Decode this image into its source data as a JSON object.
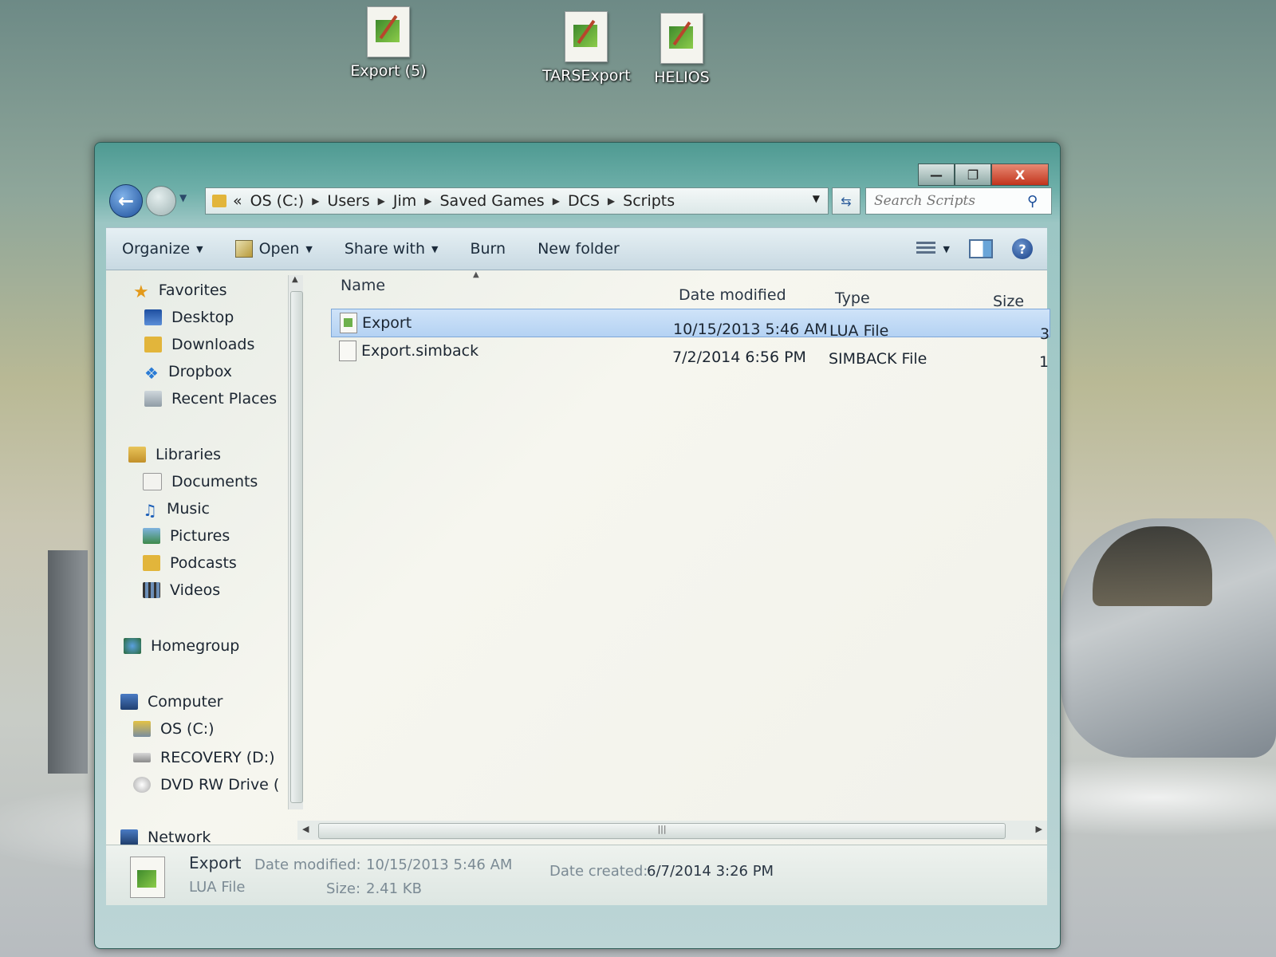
{
  "desktop": {
    "icons": [
      {
        "label": "Export (5)"
      },
      {
        "label": "TARSExport"
      },
      {
        "label": "HELIOS"
      }
    ]
  },
  "window": {
    "controls": {
      "minimize": "—",
      "maximize": "❐",
      "close": "X"
    },
    "breadcrumb": {
      "overflow": "«",
      "crumbs": [
        "OS (C:)",
        "Users",
        "Jim",
        "Saved Games",
        "DCS",
        "Scripts"
      ]
    },
    "search": {
      "placeholder": "Search Scripts"
    },
    "toolbar": {
      "organize": "Organize",
      "open": "Open",
      "share_with": "Share with",
      "burn": "Burn",
      "new_folder": "New folder"
    },
    "nav": {
      "favorites": "Favorites",
      "desktop": "Desktop",
      "downloads": "Downloads",
      "dropbox": "Dropbox",
      "recent_places": "Recent Places",
      "libraries": "Libraries",
      "documents": "Documents",
      "music": "Music",
      "pictures": "Pictures",
      "podcasts": "Podcasts",
      "videos": "Videos",
      "homegroup": "Homegroup",
      "computer": "Computer",
      "os_c": "OS (C:)",
      "recovery_d": "RECOVERY (D:)",
      "dvd": "DVD RW Drive (",
      "network": "Network"
    },
    "columns": {
      "name": "Name",
      "date": "Date modified",
      "type": "Type",
      "size": "Size"
    },
    "files": [
      {
        "name": "Export",
        "date": "10/15/2013 5:46 AM",
        "type": "LUA File",
        "size": "3",
        "selected": true
      },
      {
        "name": "Export.simback",
        "date": "7/2/2014 6:56 PM",
        "type": "SIMBACK File",
        "size": "1",
        "selected": false
      }
    ],
    "details": {
      "name": "Export",
      "type": "LUA File",
      "date_modified_label": "Date modified:",
      "date_modified": "10/15/2013 5:46 AM",
      "size_label": "Size:",
      "size": "2.41 KB",
      "date_created_label": "Date created:",
      "date_created": "6/7/2014 3:26 PM"
    }
  }
}
